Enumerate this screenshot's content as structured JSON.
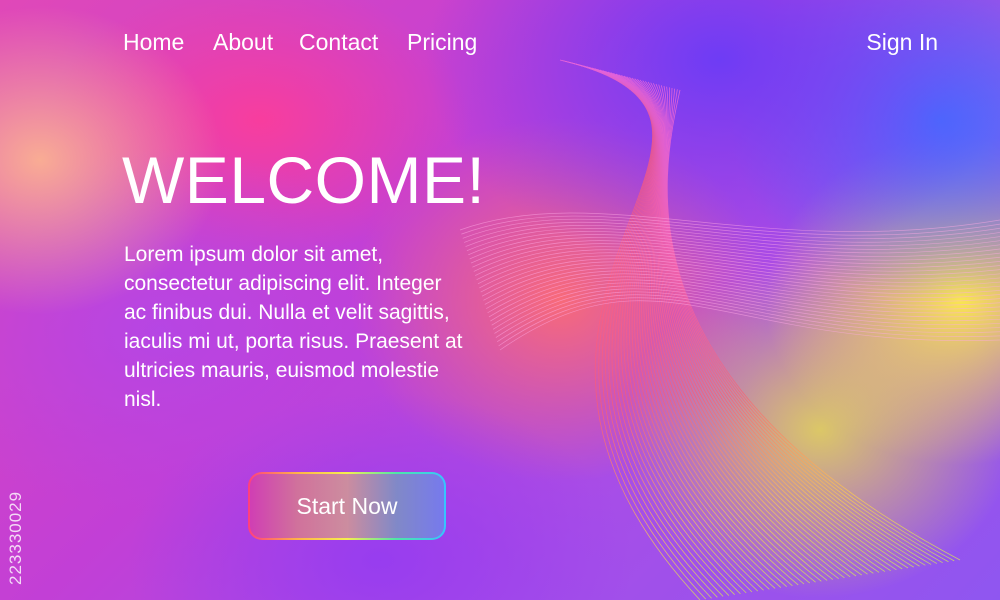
{
  "nav": {
    "items": [
      {
        "label": "Home"
      },
      {
        "label": "About"
      },
      {
        "label": "Contact"
      },
      {
        "label": "Pricing"
      }
    ],
    "signin_label": "Sign In"
  },
  "hero": {
    "title": "WELCOME!",
    "body": "Lorem ipsum dolor sit amet, consectetur adipiscing elit. Integer ac finibus dui. Nulla et velit sagittis, iaculis mi ut, porta risus. Praesent at ultricies mauris, euismod molestie nisl.",
    "cta_label": "Start Now"
  },
  "watermark": {
    "stock_id": "223330029"
  },
  "colors": {
    "text": "#ffffff",
    "gradient": [
      "#e048b8",
      "#c23fd6",
      "#8f56f0",
      "#466eff",
      "#fae650"
    ],
    "button_border": [
      "#ff3d7f",
      "#ffb347",
      "#f6ef4f",
      "#4ee6a8",
      "#38c3ff"
    ]
  }
}
